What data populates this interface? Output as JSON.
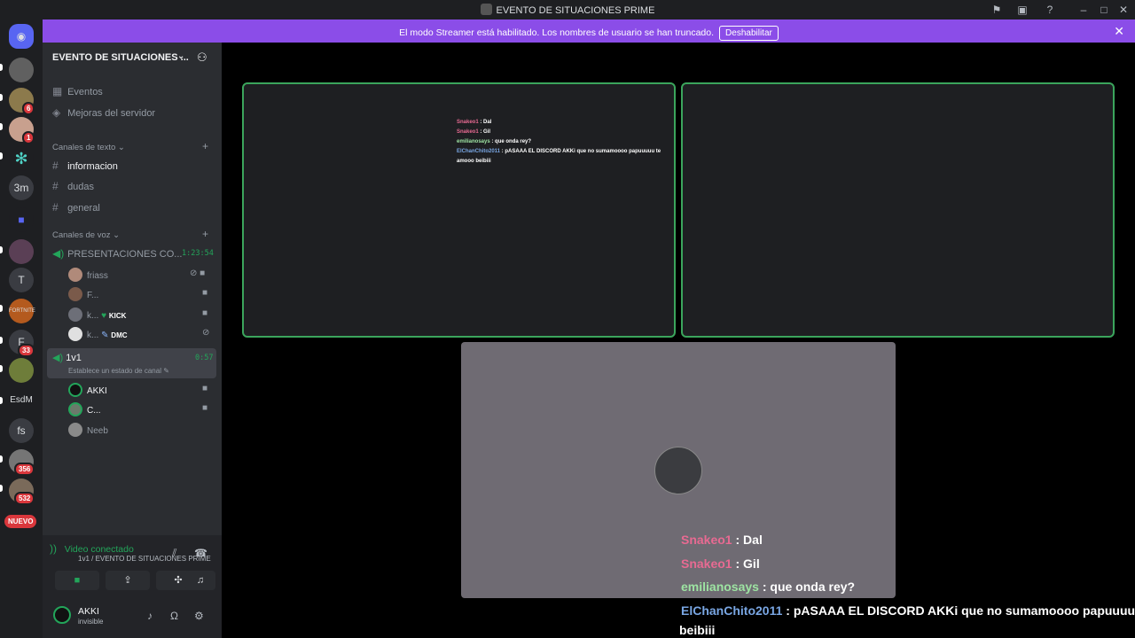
{
  "window": {
    "title": "EVENTO DE SITUACIONES PRIME"
  },
  "streamer_bar": {
    "message": "El modo Streamer está habilitado. Los nombres de usuario se han truncado.",
    "button": "Deshabilitar"
  },
  "rail": {
    "servers": [
      {
        "label": "",
        "badge": ""
      },
      {
        "label": "",
        "badge": "6"
      },
      {
        "label": "",
        "badge": "1"
      },
      {
        "label": "",
        "badge": ""
      },
      {
        "label": "3m",
        "badge": ""
      },
      {
        "label": "",
        "badge": ""
      },
      {
        "label": "",
        "badge": ""
      },
      {
        "label": "T",
        "badge": ""
      },
      {
        "label": "",
        "badge": ""
      },
      {
        "label": "F",
        "badge": "33"
      },
      {
        "label": "",
        "badge": ""
      },
      {
        "label": "EsdM",
        "badge": ""
      },
      {
        "label": "fs",
        "badge": ""
      },
      {
        "label": "",
        "badge": "356"
      },
      {
        "label": "",
        "badge": "532"
      }
    ],
    "nuevo": "NUEVO"
  },
  "sidebar": {
    "guild_name": "EVENTO DE SITUACIONES ...",
    "top_items": [
      "Eventos",
      "Mejoras del servidor"
    ],
    "text_category": "Canales de texto",
    "text_channels": [
      "informacion",
      "dudas",
      "general"
    ],
    "voice_category": "Canales de voz",
    "voice_channel_1": {
      "name": "PRESENTACIONES CO...",
      "time": "1:23:54"
    },
    "voice_users_1": [
      {
        "name": "friass",
        "tag": ""
      },
      {
        "name": "F...",
        "tag": ""
      },
      {
        "name": "k...",
        "tag": "KICK"
      },
      {
        "name": "k...",
        "tag": "DMC"
      }
    ],
    "voice_channel_2": {
      "name": "1v1",
      "time": "0:57",
      "status": "Establece un estado de canal"
    },
    "voice_users_2": [
      {
        "name": "AKKI"
      },
      {
        "name": "C..."
      },
      {
        "name": "Neeb"
      }
    ]
  },
  "panel": {
    "connected": "Video conectado",
    "location": "1v1 / EVENTO DE SITUACIONES PRIME",
    "username": "AKKI",
    "status": "invisible"
  },
  "chat_messages": [
    {
      "user": "Snakeo1",
      "text": "Dal"
    },
    {
      "user": "Snakeo1",
      "text": "Gil"
    },
    {
      "user": "emilianosays",
      "text": "que onda rey?"
    },
    {
      "user": "ElChanChito2011",
      "text": "pASAAA EL DISCORD AKKi que no sumamoooo papuuuuu te amooo beibiii"
    }
  ],
  "overlay_chat": [
    {
      "user": "Snakeo1",
      "text": "Dal"
    },
    {
      "user": "Snakeo1",
      "text": "Gil"
    },
    {
      "user": "emilianosays",
      "text": "que onda rey?"
    },
    {
      "user": "ElChanChito2011",
      "text": "pASAAA EL DISCORD AKKi que no sumamoooo papuuuuu te"
    },
    {
      "user": "",
      "text": "beibiii"
    }
  ]
}
